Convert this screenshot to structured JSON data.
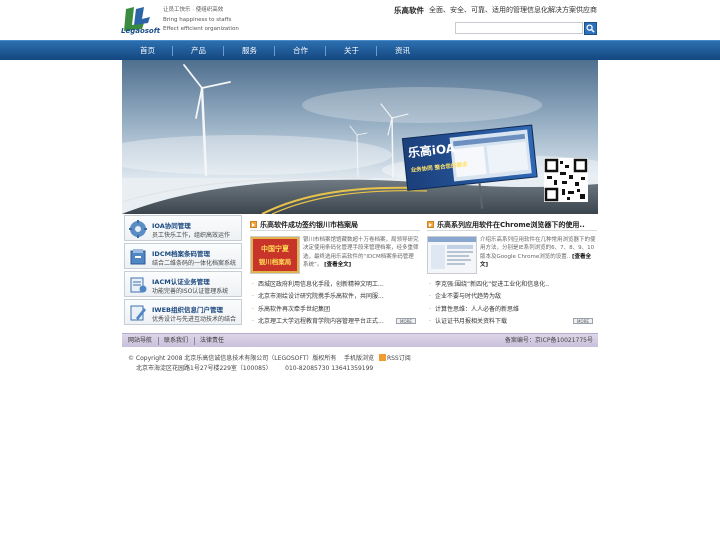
{
  "header": {
    "slogan": [
      "让员工快乐 · 使组织高效",
      "Bring happiness to staffs",
      "Effect efficient organization"
    ],
    "logo_text": "Legaosoft",
    "brand": "乐高软件",
    "tagline": "全面、安全、可靠、适用的管理信息化解决方案供应商",
    "search_placeholder": ""
  },
  "nav": [
    "首页",
    "产品",
    "服务",
    "合作",
    "关于",
    "资讯"
  ],
  "banner": {
    "title": "乐高iOA",
    "subtitle": "业务协同  整合您的需求"
  },
  "side": [
    {
      "title": "IOA协同管理",
      "desc": "员工快乐工作，组织高效运作"
    },
    {
      "title": "IDCM档案条码管理",
      "desc": "结合二维条码的一体化档案系统"
    },
    {
      "title": "IACM认证业务管理",
      "desc": "功能完善的ISO认证管理系统"
    },
    {
      "title": "IWEB组织信息门户管理",
      "desc": "优秀设计与先进互动技术的结合"
    }
  ],
  "news_left": {
    "title": "乐高软件成功签约银川市档案局",
    "feature_text": "银川市档案馆馆藏数超十万卷档案，局领导研究决定使用条码化管理手段来管理档案，经多重筛选，最终选用乐高软件的“IDCM档案条码管理系统”。",
    "feature_more": "[查看全文]",
    "image_caption": [
      "中国宁夏",
      "银川档案局"
    ],
    "items": [
      "西城区政府利用信息化手段，创新精神文明工...",
      "北京市测绘设计研究院携手乐高软件，共同服...",
      "乐高软件再次牵手世纪集团",
      "北京理工大学远程教育学院内容管理平台正式..."
    ],
    "more": "MORE"
  },
  "news_right": {
    "title": "乐高系列应用软件在Chrome浏览器下的使用..",
    "feature_text": "介绍乐高系列应用软件在几种常用浏览器下的使用方法，分别是IE系列浏览的6、7、8、9、10版本及Google Chrome浏览的设置..",
    "feature_more": "[查看全文]",
    "items": [
      "李克强:围绕“新四化”促进工业化和信息化..",
      "企业不要与时代趋势为敌",
      "计算性思维：人人必备的新思维",
      "认证证书月报相关资料下载"
    ],
    "more": "MORE"
  },
  "footer": {
    "links": [
      "网站导航",
      "联系我们",
      "法律责任"
    ],
    "icp": "备案编号：京ICP备10021775号",
    "copyright": "© Copyright 2008 北京乐高信诚信息技术有限公司（LEGOSOFT）版权所有",
    "browser_note": "手机版浏览",
    "rss": "RSS订阅",
    "address": "北京市海淀区花园路1号27号楼229室（100085）",
    "phones": "010-82085730   13641359199"
  }
}
